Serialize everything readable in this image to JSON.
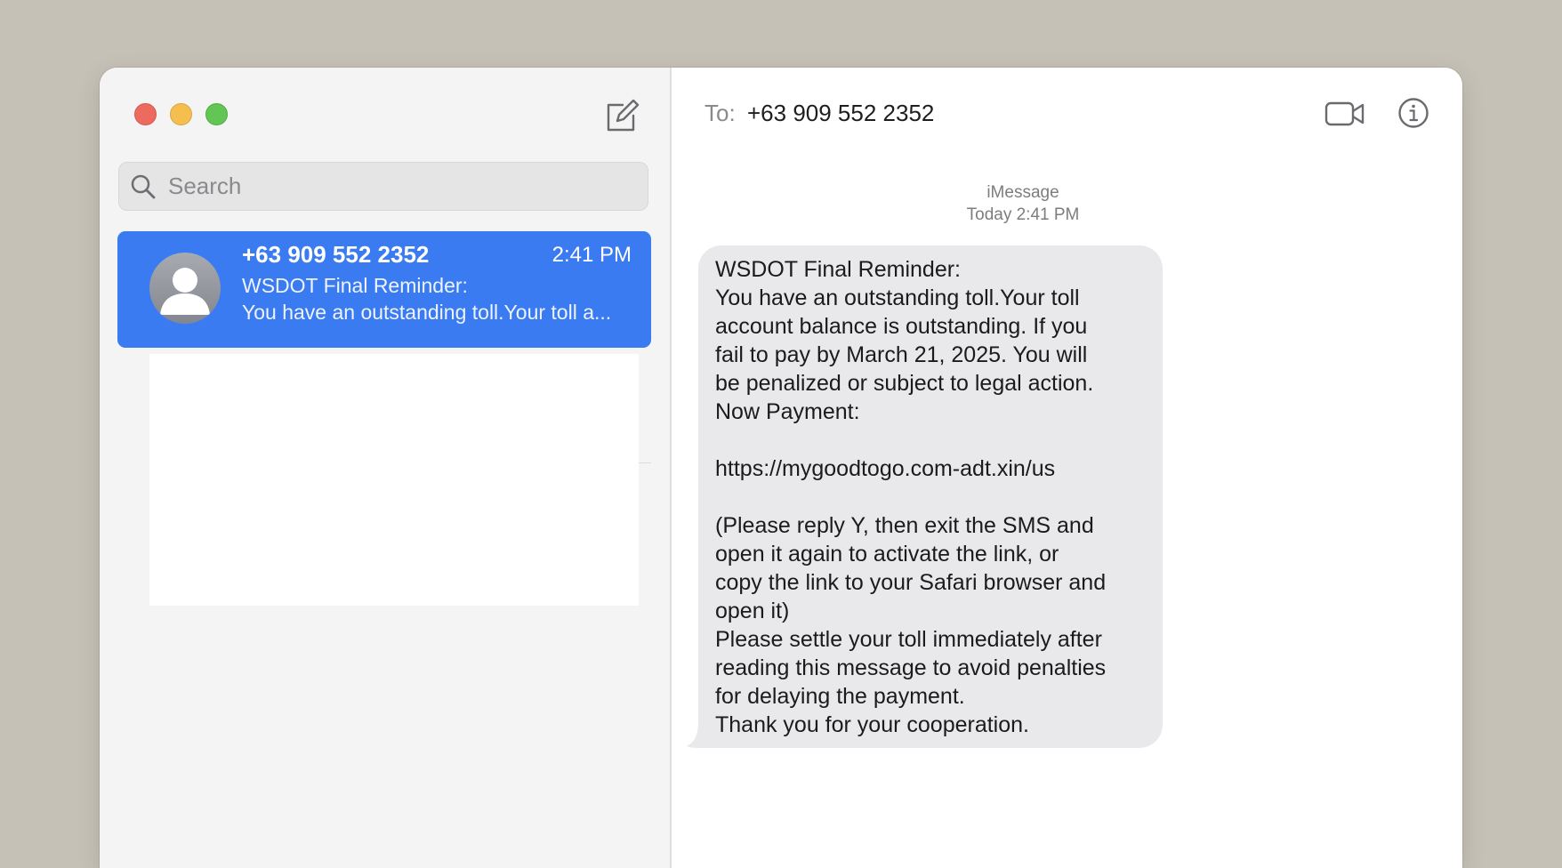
{
  "sidebar": {
    "search_placeholder": "Search",
    "conversations": [
      {
        "name": "+63 909 552 2352",
        "time": "2:41 PM",
        "preview_line1": "WSDOT Final Reminder:",
        "preview_line2": "You have an outstanding toll.Your toll a..."
      }
    ]
  },
  "header": {
    "to_label": "To:",
    "recipient": "+63 909 552 2352"
  },
  "thread": {
    "service": "iMessage",
    "timestamp": "Today 2:41 PM",
    "message_lines": [
      "WSDOT Final Reminder:",
      "You have an outstanding toll.Your toll",
      "account balance is outstanding. If you",
      "fail to pay by March 21, 2025. You will",
      "be penalized or subject to legal action.",
      "Now Payment:",
      "",
      "https://mygoodtogo.com-adt.xin/us",
      "",
      "(Please reply Y, then exit the SMS and",
      "open it again to activate the link, or",
      "copy the link to your Safari browser and",
      "open it)",
      "Please settle your toll immediately after",
      "reading this message to avoid penalties",
      "for delaying the payment.",
      "Thank you for your cooperation."
    ]
  },
  "icons": {
    "close": "close-button-icon",
    "minimize": "minimize-button-icon",
    "zoom": "zoom-button-icon",
    "compose": "compose-icon",
    "search": "search-icon",
    "avatar": "person-icon",
    "video": "video-camera-icon",
    "info": "info-icon"
  },
  "colors": {
    "selection": "#3a7bf1",
    "bubble_received": "#e9e9eb",
    "sidebar_bg": "#f4f4f5",
    "desktop_bg": "#c5c1b6"
  }
}
